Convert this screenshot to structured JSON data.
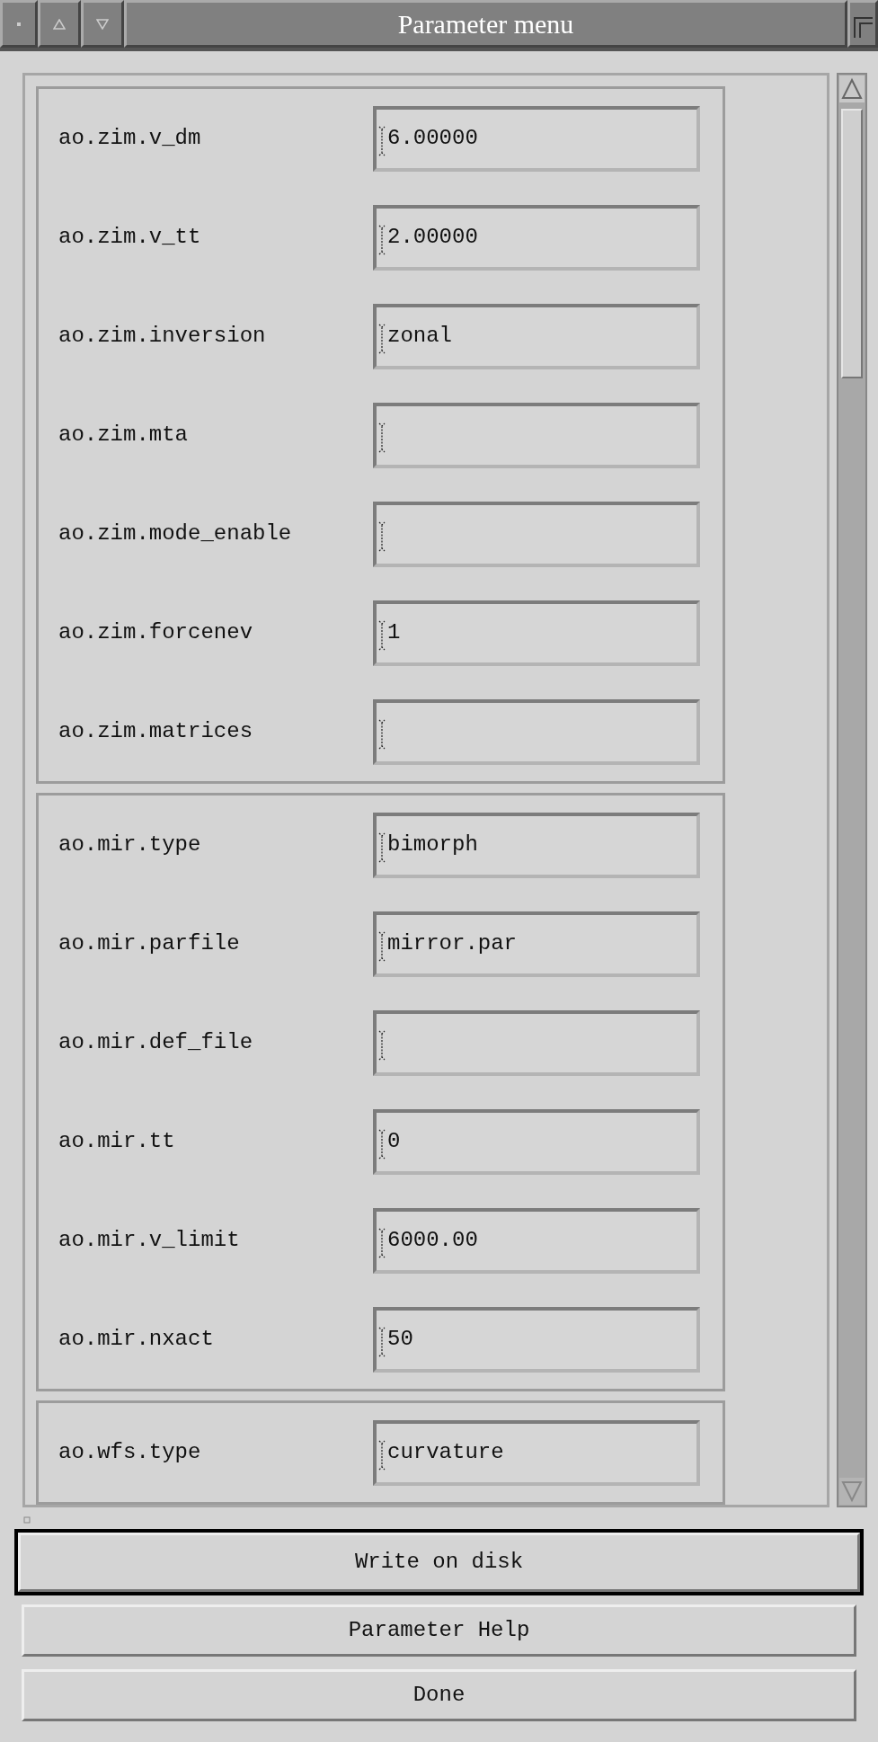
{
  "window": {
    "title": "Parameter menu"
  },
  "groups": [
    {
      "params": [
        {
          "name": "ao.zim.v_dm",
          "value": "6.00000"
        },
        {
          "name": "ao.zim.v_tt",
          "value": "2.00000"
        },
        {
          "name": "ao.zim.inversion",
          "value": "zonal"
        },
        {
          "name": "ao.zim.mta"
        },
        {
          "name": "ao.zim.mode_enable"
        },
        {
          "name": "ao.zim.forcenev",
          "value": "1"
        },
        {
          "name": "ao.zim.matrices"
        }
      ]
    },
    {
      "params": [
        {
          "name": "ao.mir.type",
          "value": "bimorph"
        },
        {
          "name": "ao.mir.parfile",
          "value": "mirror.par"
        },
        {
          "name": "ao.mir.def_file"
        },
        {
          "name": "ao.mir.tt",
          "value": "0"
        },
        {
          "name": "ao.mir.v_limit",
          "value": "6000.00"
        },
        {
          "name": "ao.mir.nxact",
          "value": "50"
        }
      ]
    },
    {
      "params": [
        {
          "name": "ao.wfs.type",
          "value": "curvature"
        }
      ]
    }
  ],
  "buttons": [
    {
      "label": "Write on disk",
      "focused": true
    },
    {
      "label": "Parameter Help",
      "focused": false
    },
    {
      "label": "Done",
      "focused": false
    }
  ]
}
